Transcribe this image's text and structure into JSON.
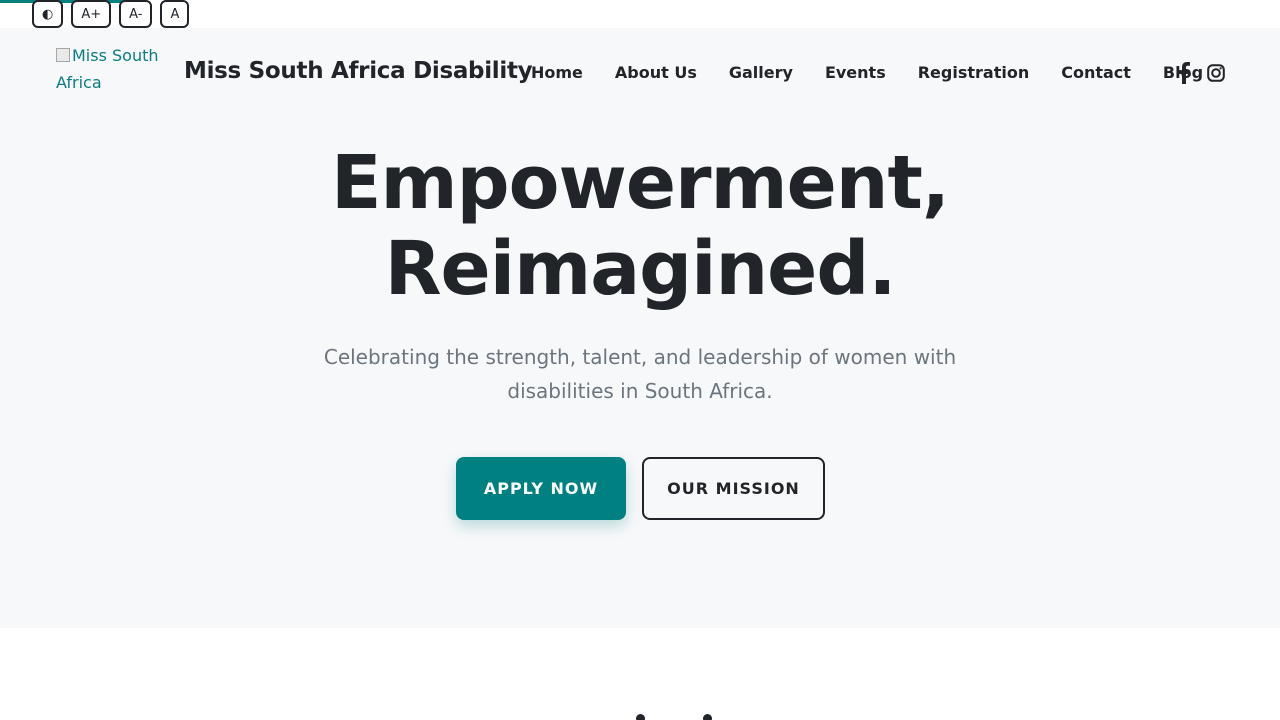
{
  "accessibility": {
    "buttons": [
      {
        "label": "◐"
      },
      {
        "label": "A+"
      },
      {
        "label": "A-"
      },
      {
        "label": "A"
      }
    ]
  },
  "header": {
    "logo_alt": "Miss South Africa",
    "brand": "Miss South Africa Disability",
    "nav": [
      {
        "label": "Home"
      },
      {
        "label": "About Us"
      },
      {
        "label": "Gallery"
      },
      {
        "label": "Events"
      },
      {
        "label": "Registration"
      },
      {
        "label": "Contact"
      },
      {
        "label": "Blog"
      }
    ],
    "social_icons": [
      "facebook-icon",
      "instagram-icon"
    ]
  },
  "hero": {
    "title_line1": "Empowerment,",
    "title_line2": "Reimagined.",
    "subtitle": "Celebrating the strength, talent, and leadership of women with disabilities in South Africa.",
    "primary_cta": "APPLY NOW",
    "secondary_cta": "OUR MISSION"
  },
  "colors": {
    "accent": "#008080",
    "nav_underline": "#f5b301",
    "text": "#212529",
    "muted_text": "#6c757d",
    "hero_background": "#f7f8fa"
  }
}
